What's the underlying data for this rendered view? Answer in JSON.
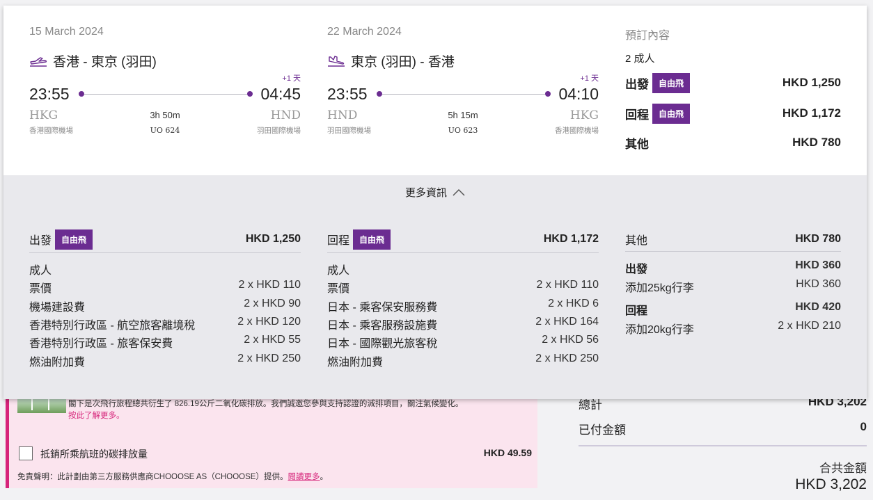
{
  "outbound": {
    "date": "15 March 2024",
    "route": "香港 - 東京 (羽田)",
    "day_offset": "+1 天",
    "dep_time": "23:55",
    "arr_time": "04:45",
    "dep_code": "HKG",
    "arr_code": "HND",
    "dep_airport": "香港國際機場",
    "arr_airport": "羽田國際機場",
    "duration": "3h 50m",
    "flight_no": "UO 624",
    "icon": "plane-takeoff-icon"
  },
  "inbound": {
    "date": "22 March 2024",
    "route": "東京 (羽田) - 香港",
    "day_offset": "+1 天",
    "dep_time": "23:55",
    "arr_time": "04:10",
    "dep_code": "HND",
    "arr_code": "HKG",
    "dep_airport": "羽田國際機場",
    "arr_airport": "香港國際機場",
    "duration": "5h 15m",
    "flight_no": "UO 623",
    "icon": "plane-landing-icon"
  },
  "summary": {
    "title": "預訂內容",
    "passengers": "2 成人",
    "outbound_label": "出發",
    "inbound_label": "回程",
    "fare_tag": "自由飛",
    "outbound_price": "HKD 1,250",
    "inbound_price": "HKD 1,172",
    "other_label": "其他",
    "other_price": "HKD 780"
  },
  "more_info": {
    "label": "更多資訊",
    "icon": "chevron-up-icon"
  },
  "detail_outbound": {
    "label": "出發",
    "tag": "自由飛",
    "total": "HKD 1,250",
    "group": "成人",
    "lines": [
      {
        "k": "票價",
        "v": "2 x HKD 110"
      },
      {
        "k": "機場建設費",
        "v": "2 x HKD 90"
      },
      {
        "k": "香港特別行政區 - 航空旅客離境稅",
        "v": "2 x HKD 120"
      },
      {
        "k": "香港特別行政區 - 旅客保安費",
        "v": "2 x HKD 55"
      },
      {
        "k": "燃油附加費",
        "v": "2 x HKD 250"
      }
    ]
  },
  "detail_inbound": {
    "label": "回程",
    "tag": "自由飛",
    "total": "HKD 1,172",
    "group": "成人",
    "lines": [
      {
        "k": "票價",
        "v": "2 x HKD 110"
      },
      {
        "k": "日本 - 乘客保安服務費",
        "v": "2 x HKD 6"
      },
      {
        "k": "日本 - 乘客服務設施費",
        "v": "2 x HKD 164"
      },
      {
        "k": "日本 - 國際觀光旅客稅",
        "v": "2 x HKD 56"
      },
      {
        "k": "燃油附加費",
        "v": "2 x HKD 250"
      }
    ]
  },
  "detail_other": {
    "label": "其他",
    "total": "HKD 780",
    "lines": [
      {
        "k": "出發",
        "v": "HKD 360",
        "bold": true
      },
      {
        "k": "添加25kg行李",
        "v": "HKD 360",
        "bold": false
      },
      {
        "k": "回程",
        "v": "HKD 420",
        "bold": true
      },
      {
        "k": "添加20kg行李",
        "v": "2 x HKD 210",
        "bold": false
      }
    ]
  },
  "eco": {
    "text": "閣下是次飛行旅程總共衍生了 826.19公斤二氧化碳排放。我們誠邀您參與支持認證的減排項目，關注氣候變化。",
    "link": "按此了解更多。",
    "checkbox_label": "抵銷所乘航班的碳排放量",
    "price": "HKD 49.59",
    "disclaimer": "免責聲明：此計劃由第三方服務供應商CHOOOSE AS（CHOOOSE）提供。",
    "disclaimer_link": "閱讀更多",
    "disclaimer_end": "。"
  },
  "totals": {
    "subtotal_label": "總計",
    "subtotal": "HKD 3,202",
    "paid_label": "已付金額",
    "paid": "0",
    "grand_label": "合共金額",
    "grand": "HKD 3,202"
  },
  "colors": {
    "brand": "#6b2c91",
    "eco_bg": "#fbe4ee",
    "eco_accent": "#d6247a"
  }
}
